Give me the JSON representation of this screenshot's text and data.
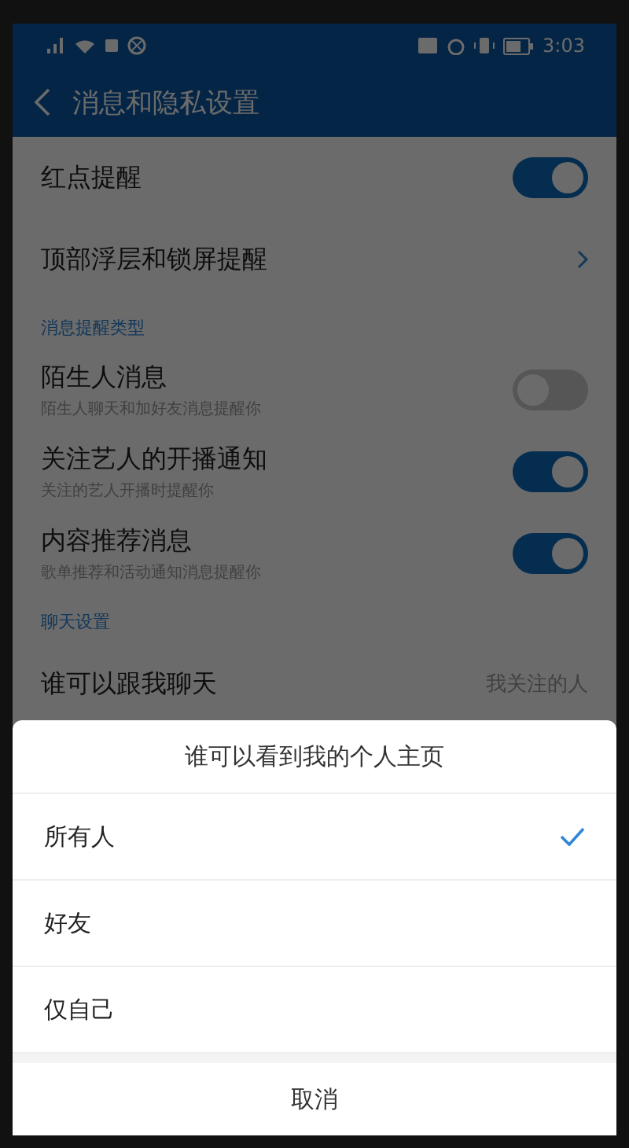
{
  "status_bar": {
    "time": "3:03"
  },
  "header": {
    "title": "消息和隐私设置"
  },
  "settings": [
    {
      "kind": "toggle",
      "label": "红点提醒",
      "on": true
    },
    {
      "kind": "link",
      "label": "顶部浮层和锁屏提醒"
    },
    {
      "kind": "section",
      "label": "消息提醒类型"
    },
    {
      "kind": "toggle",
      "label": "陌生人消息",
      "subtitle": "陌生人聊天和加好友消息提醒你",
      "on": false
    },
    {
      "kind": "toggle",
      "label": "关注艺人的开播通知",
      "subtitle": "关注的艺人开播时提醒你",
      "on": true
    },
    {
      "kind": "toggle",
      "label": "内容推荐消息",
      "subtitle": "歌单推荐和活动通知消息提醒你",
      "on": true
    },
    {
      "kind": "section",
      "label": "聊天设置"
    },
    {
      "kind": "value",
      "label": "谁可以跟我聊天",
      "value": "我关注的人"
    }
  ],
  "sheet": {
    "title": "谁可以看到我的个人主页",
    "options": [
      {
        "label": "所有人",
        "selected": true
      },
      {
        "label": "好友",
        "selected": false
      },
      {
        "label": "仅自己",
        "selected": false
      }
    ],
    "cancel": "取消"
  }
}
